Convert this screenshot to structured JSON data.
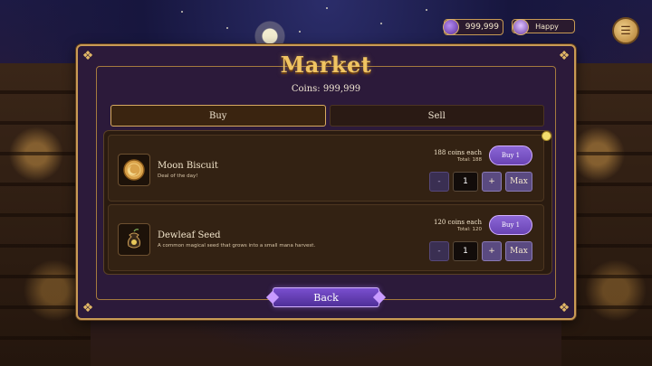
{
  "hud": {
    "coins": "999,999",
    "mood": "Happy"
  },
  "market": {
    "title": "Market",
    "coins_line": "Coins: 999,999",
    "tabs": [
      {
        "label": "Buy",
        "active": true
      },
      {
        "label": "Sell",
        "active": false
      }
    ],
    "items": [
      {
        "name": "Moon Biscuit",
        "description": "Deal of the day!",
        "price_each": "188 coins each",
        "total": "Total: 188",
        "buy_label": "Buy 1",
        "quantity": "1",
        "minus_label": "-",
        "plus_label": "+",
        "max_label": "Max",
        "icon": "moon-biscuit-icon"
      },
      {
        "name": "Dewleaf Seed",
        "description": "A common magical seed that grows into a small mana harvest.",
        "price_each": "120 coins each",
        "total": "Total: 120",
        "buy_label": "Buy 1",
        "quantity": "1",
        "minus_label": "-",
        "plus_label": "+",
        "max_label": "Max",
        "icon": "seed-pouch-icon"
      }
    ],
    "back_label": "Back"
  },
  "colors": {
    "panel": "#2c1a3a",
    "gold_border": "#c99b55",
    "buy_button": "#7a55c4",
    "title_gold": "#f0c462"
  }
}
